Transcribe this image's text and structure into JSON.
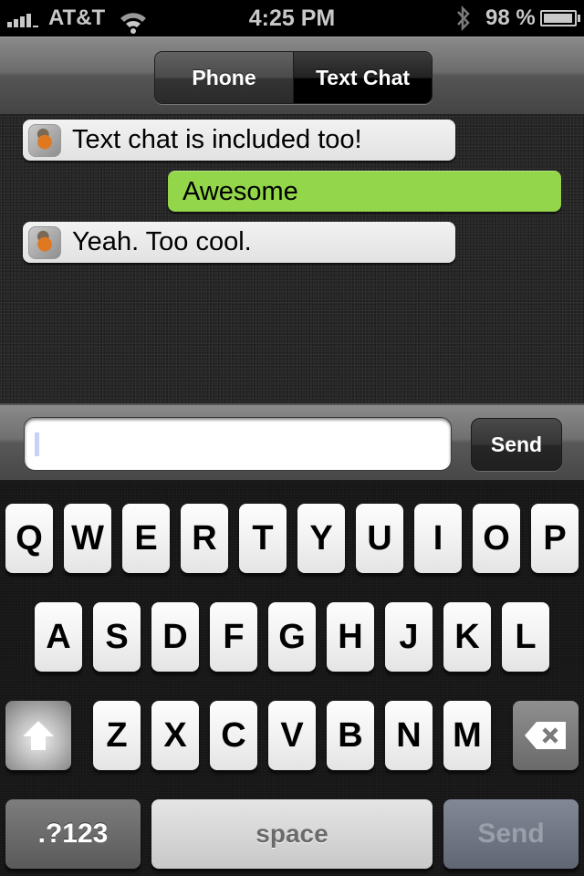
{
  "status_bar": {
    "carrier": "AT&T",
    "signal_icon": "signal-bars-icon",
    "wifi_icon": "wifi-icon",
    "time": "4:25 PM",
    "bluetooth_icon": "bluetooth-icon",
    "battery_percent": "98 %",
    "battery_level": 0.98,
    "battery_icon": "battery-icon"
  },
  "nav": {
    "segments": [
      {
        "label": "Phone",
        "selected": false
      },
      {
        "label": "Text Chat",
        "selected": true
      }
    ]
  },
  "chat": {
    "messages": [
      {
        "from": "them",
        "text": "Text chat is included too!",
        "avatar": "robin-bird-avatar"
      },
      {
        "from": "me",
        "text": "Awesome"
      },
      {
        "from": "them",
        "text": "Yeah. Too cool.",
        "avatar": "robin-bird-avatar"
      }
    ],
    "colors": {
      "incoming_bubble": "#e8e8e8",
      "outgoing_bubble": "#93d64a"
    }
  },
  "composer": {
    "input_value": "",
    "input_placeholder": "",
    "send_label": "Send"
  },
  "keyboard": {
    "row1": [
      "Q",
      "W",
      "E",
      "R",
      "T",
      "Y",
      "U",
      "I",
      "O",
      "P"
    ],
    "row2": [
      "A",
      "S",
      "D",
      "F",
      "G",
      "H",
      "J",
      "K",
      "L"
    ],
    "row3": [
      "Z",
      "X",
      "C",
      "V",
      "B",
      "N",
      "M"
    ],
    "shift_icon": "shift-arrow-icon",
    "delete_icon": "backspace-icon",
    "mode_label": ".?123",
    "space_label": "space",
    "send_label": "Send"
  }
}
